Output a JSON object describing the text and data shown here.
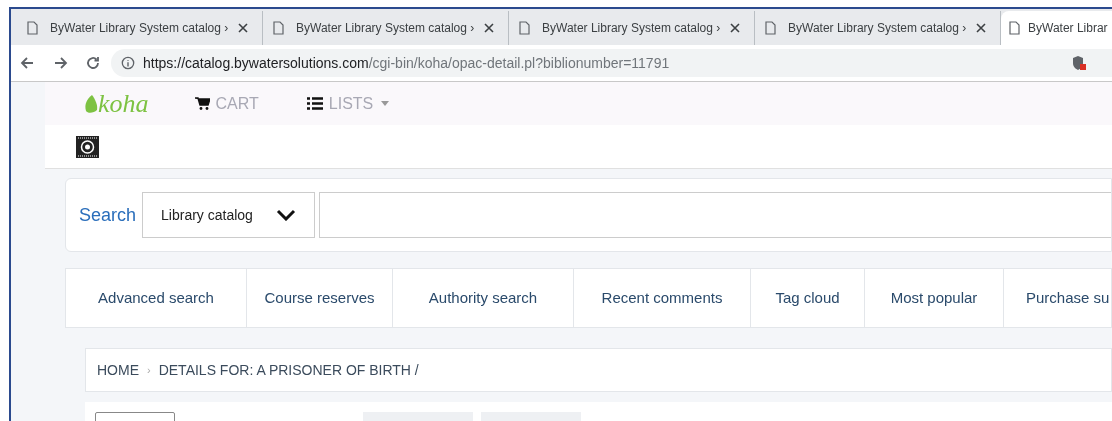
{
  "browser": {
    "tabs": [
      {
        "title": "ByWater Library System catalog ›",
        "selected": false
      },
      {
        "title": "ByWater Library System catalog ›",
        "selected": false
      },
      {
        "title": "ByWater Library System catalog ›",
        "selected": false
      },
      {
        "title": "ByWater Library System catalog ›",
        "selected": false
      },
      {
        "title": "ByWater Librar",
        "selected": true
      }
    ],
    "url_host": "https://catalog.bywatersolutions.com",
    "url_path": "/cgi-bin/koha/opac-detail.pl?biblionumber=11791"
  },
  "header": {
    "logo": "koha",
    "nav": [
      {
        "label": "CART",
        "kind": "cart"
      },
      {
        "label": "LISTS",
        "kind": "lists"
      }
    ]
  },
  "search": {
    "label": "Search",
    "scope": "Library catalog"
  },
  "menu": [
    {
      "label": "Advanced search"
    },
    {
      "label": "Course reserves"
    },
    {
      "label": "Authority search"
    },
    {
      "label": "Recent comments"
    },
    {
      "label": "Tag cloud"
    },
    {
      "label": "Most popular"
    },
    {
      "label": "Purchase su"
    }
  ],
  "breadcrumbs": [
    "HOME",
    "DETAILS FOR: A PRISONER OF BIRTH /"
  ],
  "breadcrumb_separator": "›"
}
